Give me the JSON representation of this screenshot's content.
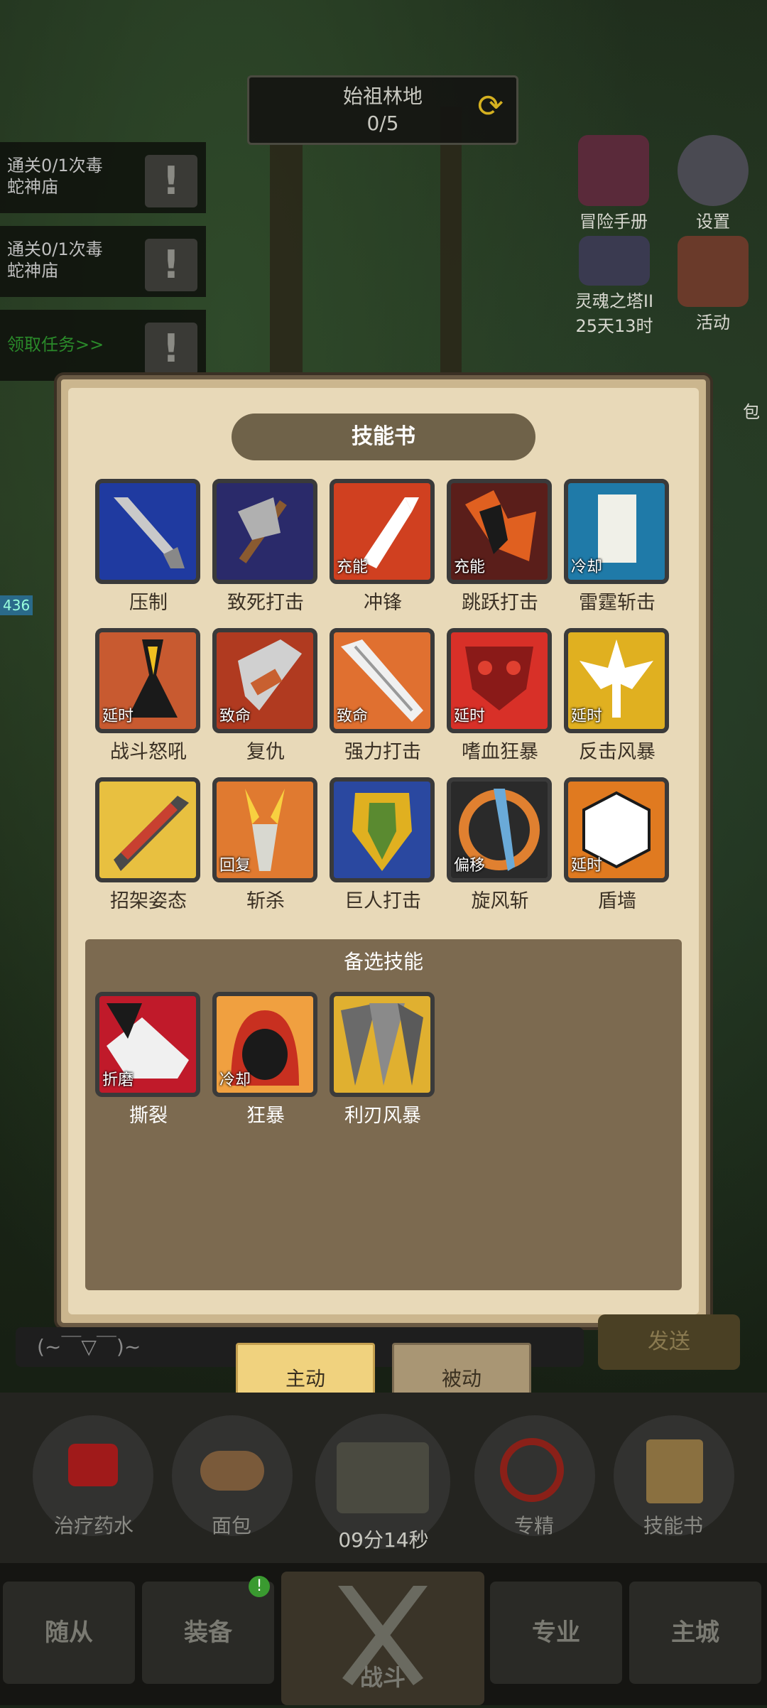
{
  "location": {
    "name": "始祖林地",
    "progress": "0/5"
  },
  "quests": [
    {
      "line1": "通关0/1次毒",
      "line2": "蛇神庙"
    },
    {
      "line1": "通关0/1次毒",
      "line2": "蛇神庙"
    }
  ],
  "quest_link": "领取任务>>",
  "side_buttons": {
    "adventure_manual": "冒险手册",
    "settings": "设置",
    "soul_tower": "灵魂之塔II",
    "soul_tower_time": "25天13时",
    "activity": "活动",
    "partial_bag": "包"
  },
  "hp_tag": "436",
  "panel": {
    "title": "技能书",
    "skills": [
      {
        "name": "压制",
        "tag": "",
        "icon": "sword-icon"
      },
      {
        "name": "致死打击",
        "tag": "",
        "icon": "axe-icon"
      },
      {
        "name": "冲锋",
        "tag": "充能",
        "icon": "arrow-blade-icon"
      },
      {
        "name": "跳跃打击",
        "tag": "充能",
        "icon": "jump-icon"
      },
      {
        "name": "雷霆斩击",
        "tag": "冷却",
        "icon": "thunder-icon"
      },
      {
        "name": "战斗怒吼",
        "tag": "延时",
        "icon": "roar-icon"
      },
      {
        "name": "复仇",
        "tag": "致命",
        "icon": "revenge-blade-icon"
      },
      {
        "name": "强力打击",
        "tag": "致命",
        "icon": "strong-blade-icon"
      },
      {
        "name": "嗜血狂暴",
        "tag": "延时",
        "icon": "blood-mask-icon"
      },
      {
        "name": "反击风暴",
        "tag": "延时",
        "icon": "counter-storm-icon"
      },
      {
        "name": "招架姿态",
        "tag": "",
        "icon": "parry-blade-icon"
      },
      {
        "name": "斩杀",
        "tag": "回复",
        "icon": "execute-icon"
      },
      {
        "name": "巨人打击",
        "tag": "",
        "icon": "giant-shield-icon"
      },
      {
        "name": "旋风斩",
        "tag": "偏移",
        "icon": "whirlwind-icon"
      },
      {
        "name": "盾墙",
        "tag": "延时",
        "icon": "shield-wall-icon"
      }
    ],
    "alt_title": "备选技能",
    "alt_skills": [
      {
        "name": "撕裂",
        "tag": "折磨",
        "icon": "rend-icon"
      },
      {
        "name": "狂暴",
        "tag": "冷却",
        "icon": "berserk-icon"
      },
      {
        "name": "利刃风暴",
        "tag": "",
        "icon": "blade-storm-icon"
      }
    ]
  },
  "chat": {
    "placeholder": "(~￣▽￣)~",
    "send": "发送"
  },
  "tabs": {
    "active": "主动",
    "passive": "被动"
  },
  "dock": {
    "potion": "治疗药水",
    "bread": "面包",
    "chest_timer": "09分14秒",
    "specialize": "专精",
    "skillbook": "技能书"
  },
  "nav": {
    "followers": "随从",
    "equipment": "装备",
    "equipment_badge": "!",
    "battle": "战斗",
    "profession": "专业",
    "main_city": "主城"
  }
}
